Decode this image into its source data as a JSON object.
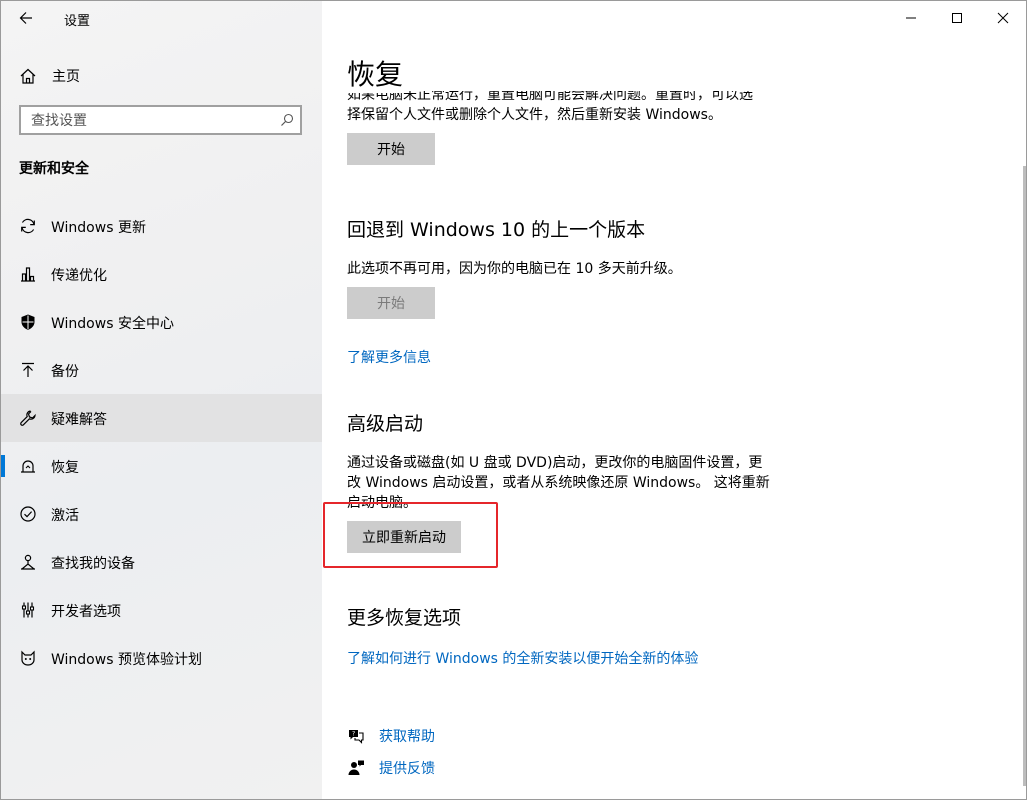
{
  "window": {
    "title": "设置"
  },
  "sidebar": {
    "home_label": "主页",
    "search_placeholder": "查找设置",
    "section_heading": "更新和安全",
    "items": [
      {
        "label": "Windows 更新",
        "icon": "sync-icon"
      },
      {
        "label": "传递优化",
        "icon": "delivery-optimization-icon"
      },
      {
        "label": "Windows 安全中心",
        "icon": "shield-icon"
      },
      {
        "label": "备份",
        "icon": "backup-upload-icon"
      },
      {
        "label": "疑难解答",
        "icon": "wrench-icon"
      },
      {
        "label": "恢复",
        "icon": "recovery-icon",
        "selected": true
      },
      {
        "label": "激活",
        "icon": "check-circle-icon"
      },
      {
        "label": "查找我的设备",
        "icon": "find-device-icon"
      },
      {
        "label": "开发者选项",
        "icon": "developer-icon"
      },
      {
        "label": "Windows 预览体验计划",
        "icon": "insider-cat-icon"
      }
    ]
  },
  "content": {
    "page_title": "恢复",
    "reset": {
      "cut_text_line1": "如果电脑未正常运行，重置电脑可能会解决问题。重置时，可以选",
      "cut_text_line2": "择保留个人文件或删除个人文件，然后重新安装 Windows。",
      "button_label": "开始"
    },
    "go_back": {
      "heading": "回退到 Windows 10 的上一个版本",
      "text": "此选项不再可用，因为你的电脑已在 10 多天前升级。",
      "button_label": "开始",
      "link": "了解更多信息"
    },
    "advanced_startup": {
      "heading": "高级启动",
      "text_line1": "通过设备或磁盘(如 U 盘或 DVD)启动，更改你的电脑固件设置，更",
      "text_line2": "改 Windows 启动设置，或者从系统映像还原 Windows。 这将重新",
      "text_line3": "启动电脑。",
      "button_label": "立即重新启动"
    },
    "more_options": {
      "heading": "更多恢复选项",
      "link": "了解如何进行 Windows 的全新安装以便开始全新的体验"
    },
    "help": {
      "get_help": "获取帮助",
      "feedback": "提供反馈"
    }
  },
  "colors": {
    "accent": "#0078d7",
    "link": "#0067c0",
    "highlight_box": "#e5262b",
    "button_bg": "#cccccc"
  }
}
